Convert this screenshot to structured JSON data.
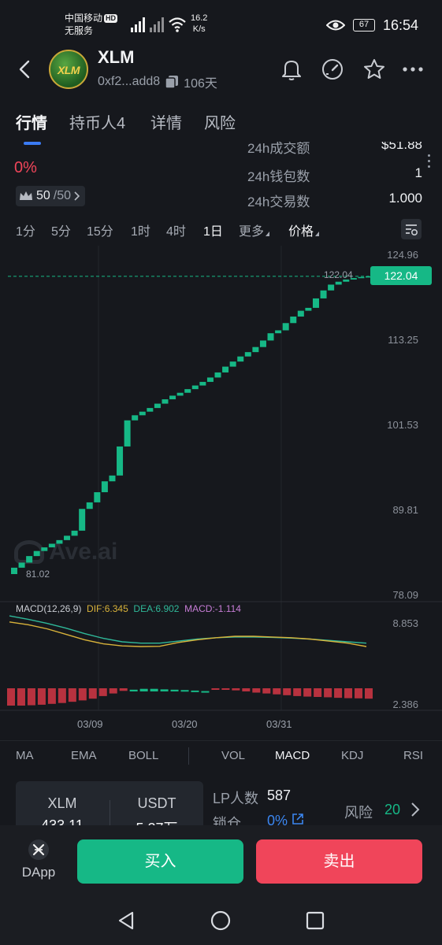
{
  "status_bar": {
    "carrier": "中国移动",
    "hd": "HD",
    "no_service": "无服务",
    "speed_value": "16.2",
    "speed_unit": "K/s",
    "battery": "67",
    "time": "16:54"
  },
  "header": {
    "token_logo_text": "XLM",
    "token_name": "XLM",
    "address": "0xf2...add8",
    "age": "106天"
  },
  "tabs": [
    {
      "label": "行情",
      "active": true
    },
    {
      "label": "持币人4"
    },
    {
      "label": "详情"
    },
    {
      "label": "风险"
    }
  ],
  "stats": {
    "price_change": "0%",
    "vip_current": "50",
    "vip_total": "/50",
    "rows": [
      {
        "label": "24h成交额",
        "value": "$51.88"
      },
      {
        "label": "24h钱包数",
        "value": "1"
      },
      {
        "label": "24h交易数",
        "value": "1.000"
      }
    ]
  },
  "intervals": [
    {
      "label": "1分"
    },
    {
      "label": "5分"
    },
    {
      "label": "15分"
    },
    {
      "label": "1时"
    },
    {
      "label": "4时"
    },
    {
      "label": "1日",
      "active": true
    },
    {
      "label": "更多"
    },
    {
      "label": "价格"
    }
  ],
  "chart": {
    "watermark": "Ave.ai",
    "price_tag": "122.04",
    "high_label": "122.04",
    "low_label": "81.02",
    "macd_legend": {
      "name": "MACD(12,26,9)",
      "dif": "DIF:6.345",
      "dea": "DEA:6.902",
      "macd": "MACD:-1.114"
    },
    "colors": {
      "up": "#16b886",
      "down": "#b8323f",
      "dif": "#d8b23a",
      "dea": "#2fb899",
      "macd": "#c77dd6"
    }
  },
  "chart_data": {
    "type": "candlestick",
    "y_axis_labels": [
      "124.96",
      "113.25",
      "101.53",
      "89.81",
      "78.09"
    ],
    "ylim": [
      78.09,
      124.96
    ],
    "x_labels": [
      "03/09",
      "03/20",
      "03/31"
    ],
    "last_price": 122.04,
    "candles": [
      {
        "o": 81.02,
        "c": 81.9
      },
      {
        "o": 81.9,
        "c": 82.6
      },
      {
        "o": 82.6,
        "c": 83.5
      },
      {
        "o": 83.5,
        "c": 84.2
      },
      {
        "o": 84.2,
        "c": 84.7
      },
      {
        "o": 84.7,
        "c": 85.2
      },
      {
        "o": 85.2,
        "c": 85.7
      },
      {
        "o": 85.7,
        "c": 86.3
      },
      {
        "o": 86.3,
        "c": 87.0
      },
      {
        "o": 87.0,
        "c": 90.0
      },
      {
        "o": 90.0,
        "c": 90.9
      },
      {
        "o": 90.9,
        "c": 92.3
      },
      {
        "o": 92.3,
        "c": 93.8
      },
      {
        "o": 93.8,
        "c": 94.6
      },
      {
        "o": 94.6,
        "c": 98.6
      },
      {
        "o": 98.6,
        "c": 102.2
      },
      {
        "o": 102.2,
        "c": 102.9
      },
      {
        "o": 102.9,
        "c": 103.4
      },
      {
        "o": 103.4,
        "c": 103.9
      },
      {
        "o": 103.9,
        "c": 104.5
      },
      {
        "o": 104.5,
        "c": 105.1
      },
      {
        "o": 105.1,
        "c": 105.6
      },
      {
        "o": 105.6,
        "c": 106.0
      },
      {
        "o": 106.0,
        "c": 106.5
      },
      {
        "o": 106.5,
        "c": 107.0
      },
      {
        "o": 107.0,
        "c": 107.5
      },
      {
        "o": 107.5,
        "c": 108.1
      },
      {
        "o": 108.1,
        "c": 108.8
      },
      {
        "o": 108.8,
        "c": 109.6
      },
      {
        "o": 109.6,
        "c": 110.3
      },
      {
        "o": 110.3,
        "c": 111.0
      },
      {
        "o": 111.0,
        "c": 111.6
      },
      {
        "o": 111.6,
        "c": 112.3
      },
      {
        "o": 112.3,
        "c": 113.2
      },
      {
        "o": 113.2,
        "c": 114.2
      },
      {
        "o": 114.2,
        "c": 114.6
      },
      {
        "o": 114.6,
        "c": 115.6
      },
      {
        "o": 115.6,
        "c": 116.5
      },
      {
        "o": 116.5,
        "c": 117.3
      },
      {
        "o": 117.3,
        "c": 117.7
      },
      {
        "o": 117.7,
        "c": 119.0
      },
      {
        "o": 119.0,
        "c": 120.1
      },
      {
        "o": 120.1,
        "c": 120.9
      },
      {
        "o": 120.9,
        "c": 121.3
      },
      {
        "o": 121.3,
        "c": 121.6
      },
      {
        "o": 121.6,
        "c": 121.8
      },
      {
        "o": 121.8,
        "c": 121.95
      },
      {
        "o": 121.95,
        "c": 122.04
      }
    ],
    "macd": {
      "y_labels": [
        "8.853",
        "2.386"
      ],
      "ylim": [
        2.386,
        8.853
      ],
      "dif": [
        8.4,
        8.2,
        7.9,
        7.5,
        7.1,
        6.8,
        6.65,
        6.6,
        6.62,
        6.9,
        7.1,
        7.25,
        7.35,
        7.35,
        7.3,
        7.25,
        7.15,
        7.0,
        6.85,
        6.6
      ],
      "dea": [
        8.85,
        8.6,
        8.3,
        7.95,
        7.55,
        7.2,
        6.95,
        6.85,
        6.85,
        7.0,
        7.15,
        7.25,
        7.3,
        7.3,
        7.27,
        7.22,
        7.15,
        7.05,
        6.95,
        6.85
      ],
      "hist": [
        -1.0,
        -1.0,
        -0.98,
        -0.95,
        -0.9,
        -0.85,
        -0.78,
        -0.7,
        -0.6,
        -0.45,
        -0.3,
        -0.15,
        0.1,
        0.15,
        0.15,
        0.12,
        0.1,
        0.08,
        0.05,
        0.02,
        -0.05,
        -0.08,
        -0.12,
        -0.18,
        -0.25,
        -0.3,
        -0.35,
        -0.4,
        -0.45,
        -0.48,
        -0.5,
        -0.52,
        -0.55,
        -0.57,
        -0.58,
        -0.6
      ]
    }
  },
  "indicators": [
    {
      "label": "MA"
    },
    {
      "label": "EMA"
    },
    {
      "label": "BOLL"
    },
    {
      "label": "VOL"
    },
    {
      "label": "MACD",
      "active": true
    },
    {
      "label": "KDJ"
    },
    {
      "label": "RSI"
    }
  ],
  "pool": {
    "base_symbol": "XLM",
    "base_amount": "433.11",
    "quote_symbol": "USDT",
    "quote_amount": "5.27万",
    "lp_label": "LP人数",
    "lp_value": "587",
    "lock_label": "锁仓",
    "lock_value": "0%",
    "risk_label": "风险",
    "risk_value": "20"
  },
  "actions": {
    "dapp": "DApp",
    "buy": "买入",
    "sell": "卖出"
  }
}
